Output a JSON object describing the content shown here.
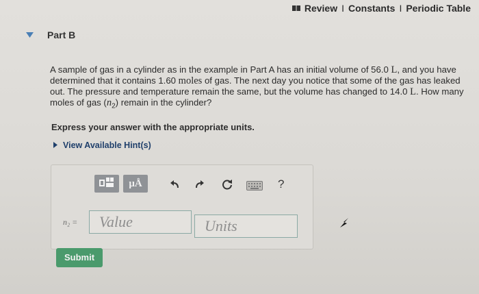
{
  "nav": {
    "review": "Review",
    "sep1": "I",
    "constants": "Constants",
    "sep2": "I",
    "periodic_table": "Periodic Table"
  },
  "part": {
    "title": "Part B"
  },
  "question": {
    "t1": "A sample of gas in a cylinder as in the example in Part A has an initial volume of 56.0 ",
    "unit_L1": "L",
    "t2": ", and you have determined that it contains 1.60 ",
    "unit_moles": "moles",
    "t3": " of gas. The next day you notice that some of the gas has leaked out. The pressure and temperature remain the same, but the volume has changed to 14.0 ",
    "unit_L2": "L",
    "t4": ". How many moles of gas (",
    "var": "n",
    "var_sub": "2",
    "t5": ") remain in the cylinder?"
  },
  "instruction": "Express your answer with the appropriate units.",
  "hint": {
    "label": "View Available Hint(s)"
  },
  "toolbar": {
    "units_button": "μÅ",
    "help": "?",
    "icons": [
      "templates-icon",
      "units-icon",
      "undo-icon",
      "redo-icon",
      "reset-icon",
      "keyboard-icon",
      "help-icon"
    ]
  },
  "answer": {
    "label": "n₂ =",
    "value_placeholder": "Value",
    "units_placeholder": "Units"
  },
  "submit": {
    "label": "Submit"
  },
  "colors": {
    "submit": "#4a9a6c",
    "input_border": "#8aa9a4",
    "toolbar_button": "#8f9296",
    "hint_link": "#1f3f6b"
  }
}
